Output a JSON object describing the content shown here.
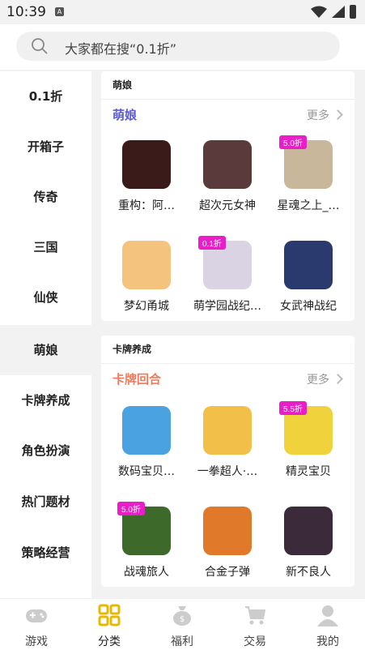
{
  "status": {
    "time": "10:39",
    "a_label": "A"
  },
  "search": {
    "placeholder": "大家都在搜“0.1折”"
  },
  "sidebar": {
    "items": [
      {
        "label": "0.1折"
      },
      {
        "label": "开箱子"
      },
      {
        "label": "传奇"
      },
      {
        "label": "三国"
      },
      {
        "label": "仙侠"
      },
      {
        "label": "萌娘"
      },
      {
        "label": "卡牌养成"
      },
      {
        "label": "角色扮演"
      },
      {
        "label": "热门题材"
      },
      {
        "label": "策略经营"
      }
    ],
    "active": "萌娘"
  },
  "sections": [
    {
      "header": "萌娘",
      "sub_title": "萌娘",
      "sub_color": "#5a5ad8",
      "more": "更多",
      "games": [
        {
          "name": "重构：阿…",
          "badge": "",
          "color": "#3b1a1a"
        },
        {
          "name": "超次元女神",
          "badge": "",
          "color": "#5a3a3a"
        },
        {
          "name": "星魂之上_…",
          "badge": "5.0折",
          "color": "#c9b79c"
        },
        {
          "name": "梦幻甬城",
          "badge": "",
          "color": "#f4c37e"
        },
        {
          "name": "萌学园战纪…",
          "badge": "0.1折",
          "color": "#d9d3e4"
        },
        {
          "name": "女武神战纪",
          "badge": "",
          "color": "#2b3a6e"
        }
      ]
    },
    {
      "header": "卡牌养成",
      "sub_title": "卡牌回合",
      "sub_color": "#f07a5a",
      "more": "更多",
      "games": [
        {
          "name": "数码宝贝…",
          "badge": "",
          "color": "#4aa3e0"
        },
        {
          "name": "一拳超人·…",
          "badge": "",
          "color": "#f2c049"
        },
        {
          "name": "精灵宝贝",
          "badge": "5.5折",
          "color": "#f0d23c"
        },
        {
          "name": "战魂旅人",
          "badge": "5.0折",
          "color": "#3d6a2a"
        },
        {
          "name": "合金子弹",
          "badge": "",
          "color": "#e07a2a"
        },
        {
          "name": "新不良人",
          "badge": "",
          "color": "#3a2a3a"
        }
      ]
    }
  ],
  "tabbar": [
    {
      "label": "游戏",
      "icon": "gamepad-icon"
    },
    {
      "label": "分类",
      "icon": "grid-icon",
      "active": true
    },
    {
      "label": "福利",
      "icon": "gift-bag-icon"
    },
    {
      "label": "交易",
      "icon": "cart-icon"
    },
    {
      "label": "我的",
      "icon": "user-icon"
    }
  ]
}
